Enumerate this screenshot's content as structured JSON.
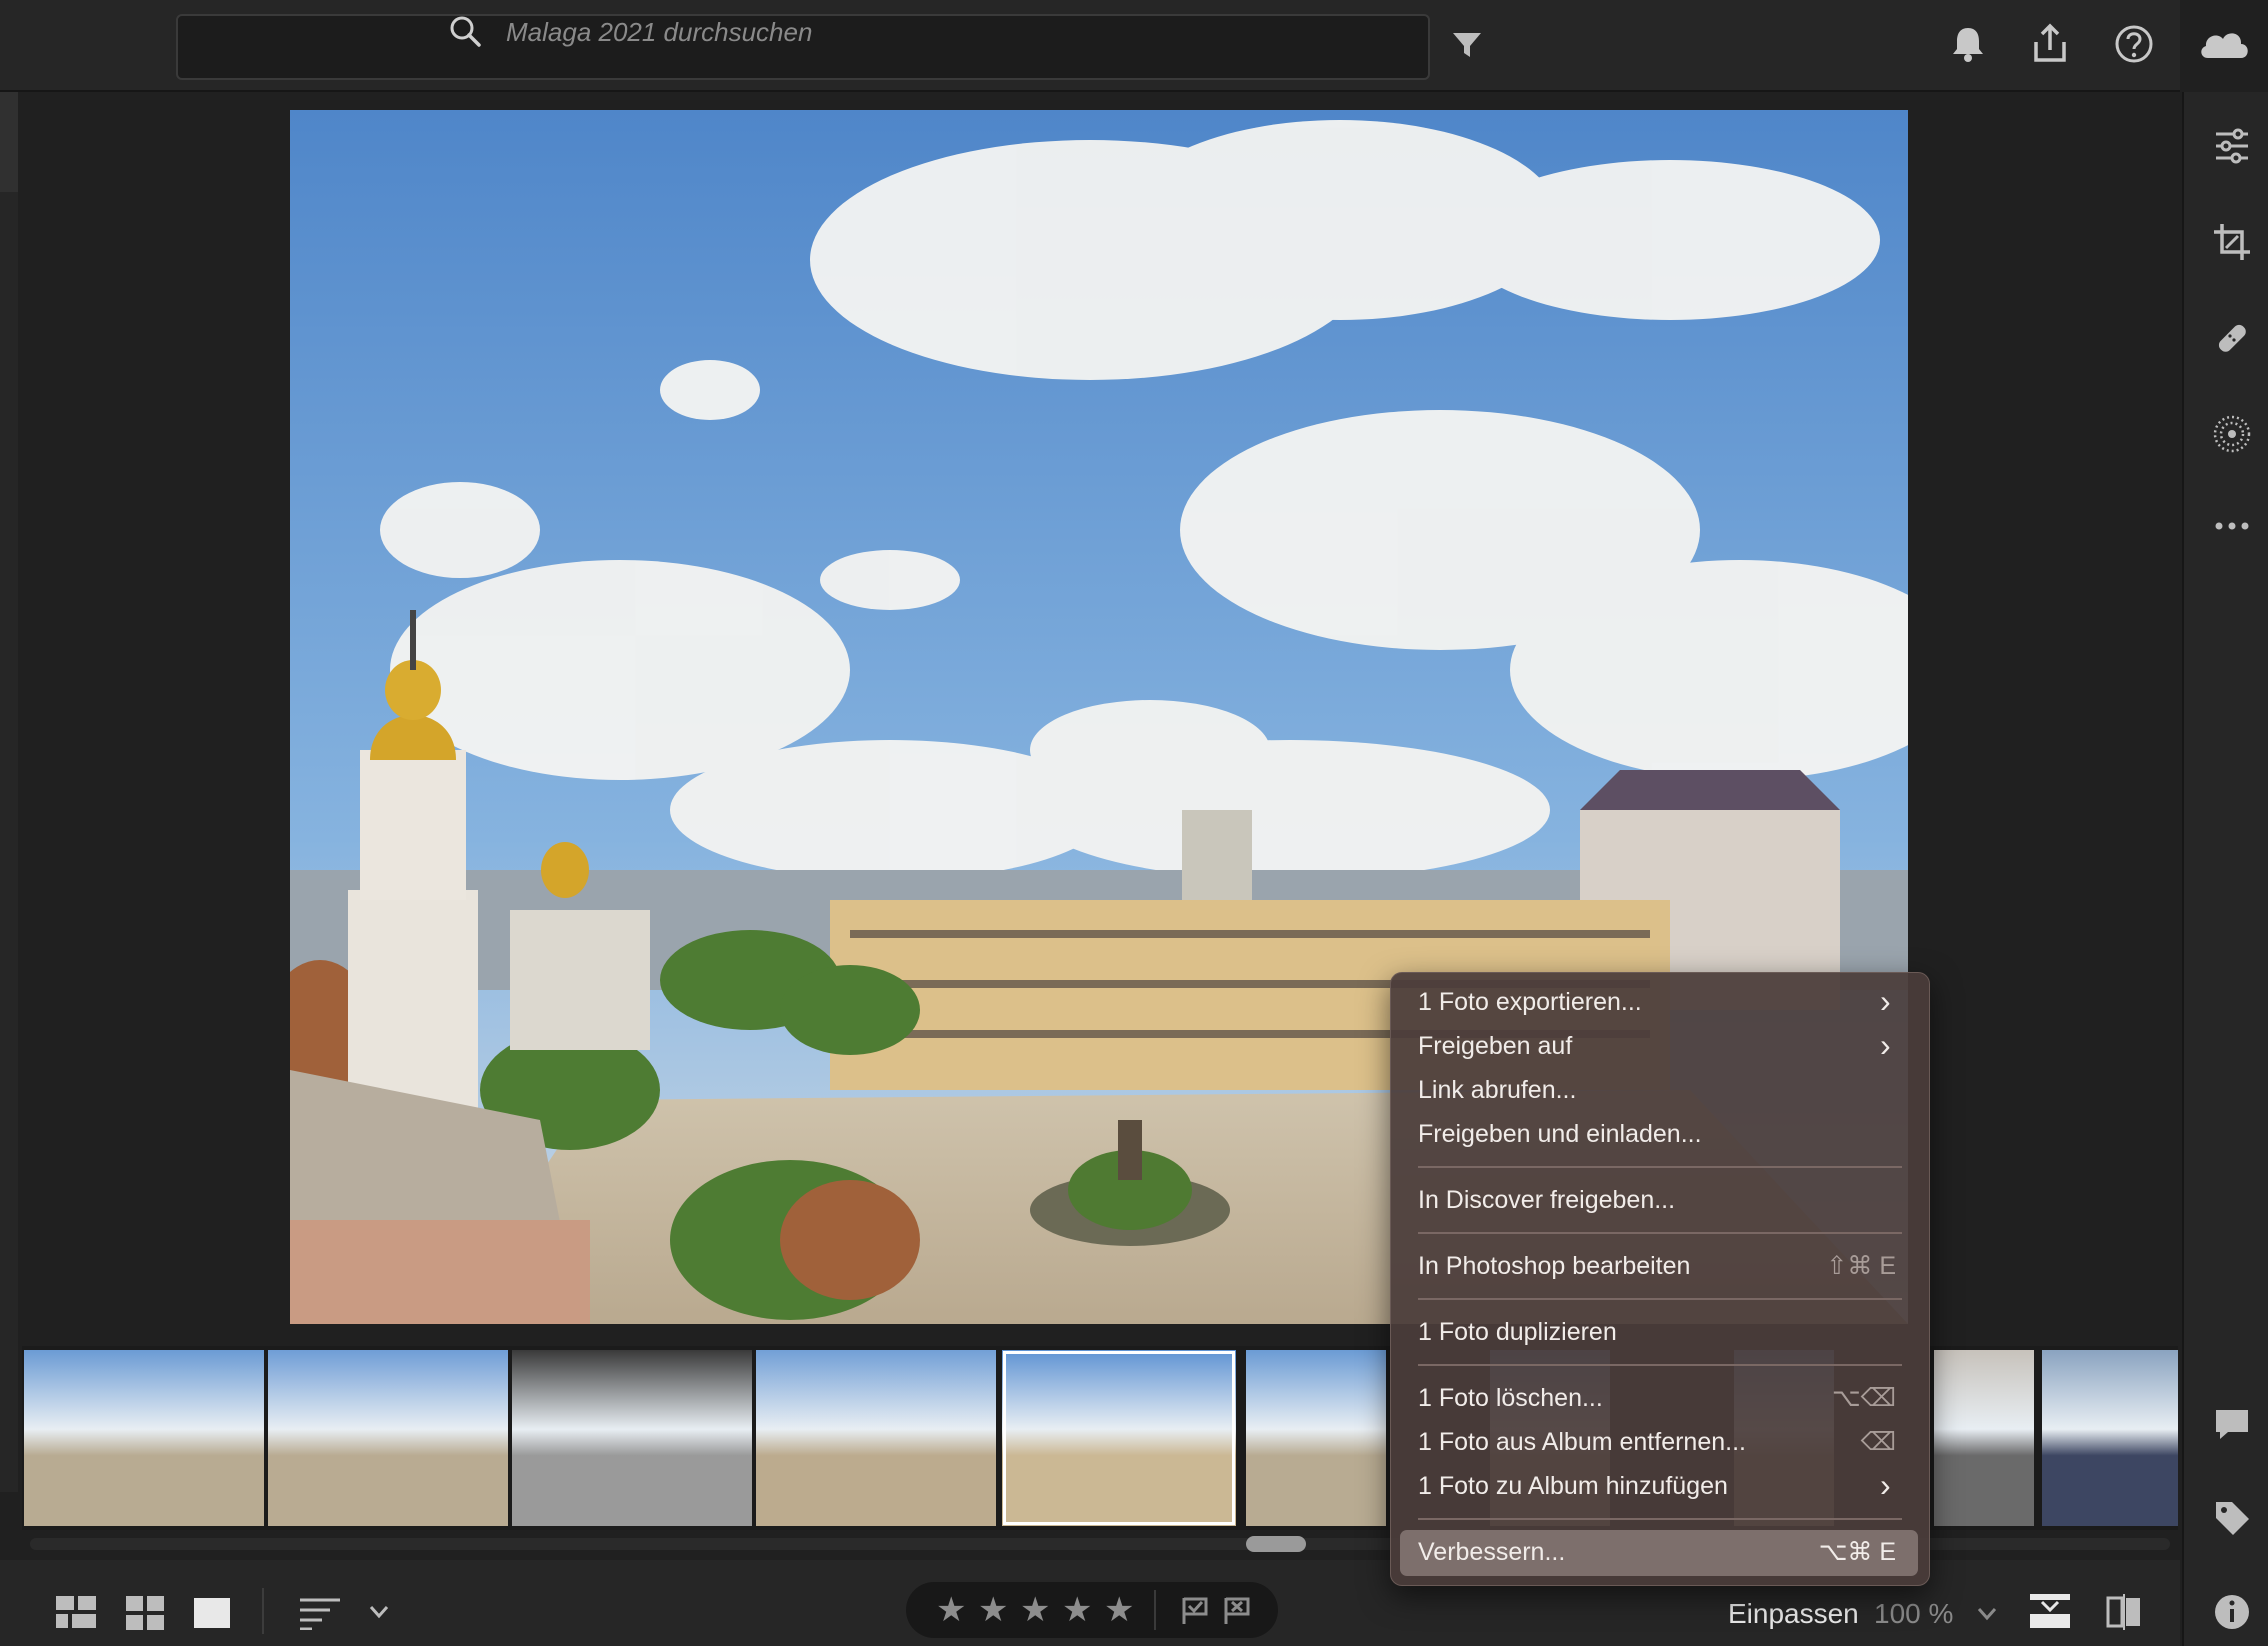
{
  "search": {
    "placeholder": "Malaga 2021 durchsuchen"
  },
  "topbar": {
    "icons": [
      "bell-icon",
      "share-icon",
      "help-icon",
      "cloud-icon"
    ]
  },
  "right_panel": {
    "icons": [
      "sliders-icon",
      "crop-icon",
      "healing-icon",
      "masking-icon",
      "more-icon",
      "comment-icon",
      "tag-icon",
      "info-icon"
    ]
  },
  "context_menu": {
    "items": [
      {
        "label": "1 Foto exportieren...",
        "shortcut": "",
        "submenu": true
      },
      {
        "label": "Freigeben auf",
        "shortcut": "",
        "submenu": true
      },
      {
        "label": "Link abrufen...",
        "shortcut": "",
        "submenu": false
      },
      {
        "label": "Freigeben und einladen...",
        "shortcut": "",
        "submenu": false
      },
      {
        "label": "In Discover freigeben...",
        "shortcut": "",
        "submenu": false
      },
      {
        "label": "In Photoshop bearbeiten",
        "shortcut": "⇧⌘ E",
        "submenu": false
      },
      {
        "label": "1 Foto duplizieren",
        "shortcut": "",
        "submenu": false
      },
      {
        "label": "1 Foto löschen...",
        "shortcut": "⌥⌫",
        "submenu": false
      },
      {
        "label": "1 Foto aus Album entfernen...",
        "shortcut": "⌫",
        "submenu": false
      },
      {
        "label": "1 Foto zu Album hinzufügen",
        "shortcut": "",
        "submenu": true
      },
      {
        "label": "Verbessern...",
        "shortcut": "⌥⌘ E",
        "submenu": false,
        "highlighted": true
      }
    ]
  },
  "bottombar": {
    "zoom_fit": "Einpassen",
    "zoom_value": "100 %",
    "rating_stars": 5,
    "rating_value": 0
  },
  "filmstrip": {
    "thumbnail_count": 11,
    "selected_index": 4
  },
  "colors": {
    "background": "#202020",
    "panel": "#262626",
    "menu": "#4a3c3a",
    "highlight": "#7d6f6c"
  }
}
